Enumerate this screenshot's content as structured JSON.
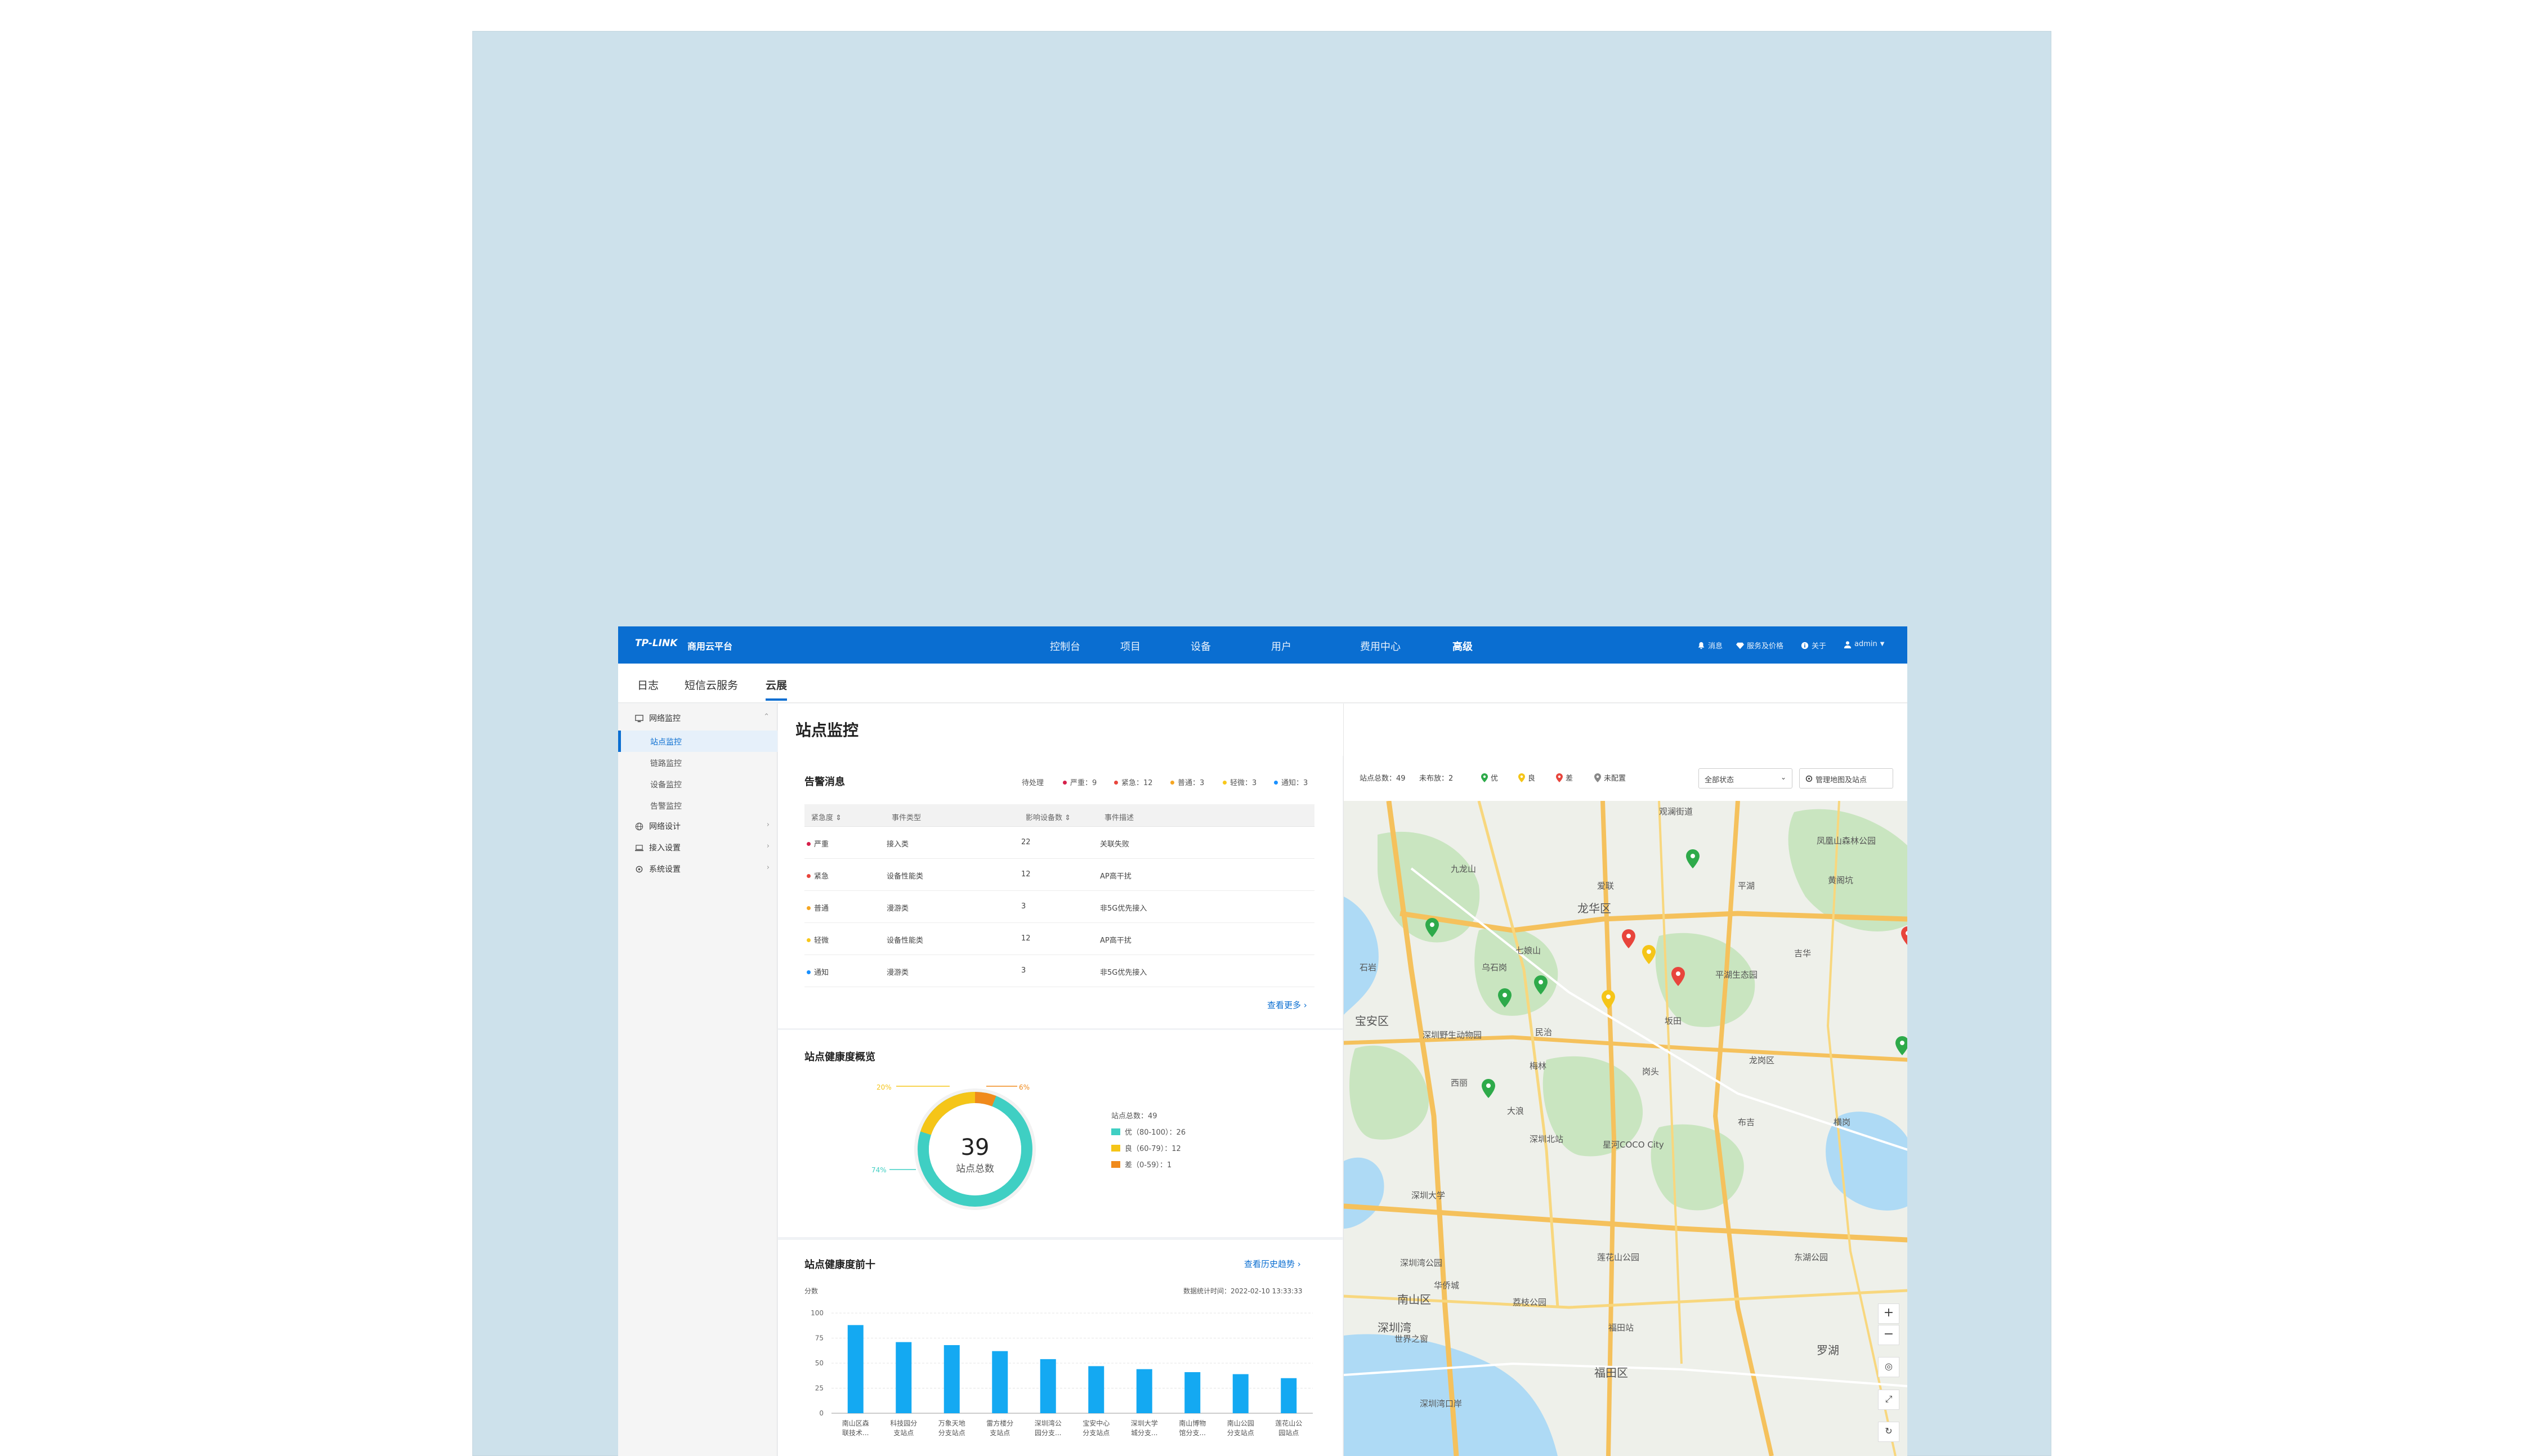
{
  "topbar": {
    "logo": "TP-LINK",
    "brand": "商用云平台",
    "nav": [
      "控制台",
      "项目",
      "设备",
      "用户",
      "费用中心",
      "高级"
    ],
    "active_nav": "高级",
    "right": {
      "notice": "消息",
      "service": "服务及价格",
      "about": "关于",
      "user": "admin"
    }
  },
  "subnav": {
    "tabs": [
      "日志",
      "短信云服务",
      "云展"
    ],
    "active": "云展"
  },
  "sidebar": {
    "group_monitor": "网络监控",
    "items": [
      "站点监控",
      "链路监控",
      "设备监控",
      "告警监控"
    ],
    "active_item": "站点监控",
    "group_design": "网络设计",
    "group_access": "接入设置",
    "group_system": "系统设置"
  },
  "page": {
    "title": "站点监控"
  },
  "alarms": {
    "title": "告警消息",
    "pending": "待处理",
    "counts": [
      {
        "label": "严重：9",
        "color": "#d6204b"
      },
      {
        "label": "紧急：12",
        "color": "#e8453c"
      },
      {
        "label": "普通：3",
        "color": "#f5a623"
      },
      {
        "label": "轻微：3",
        "color": "#f8c81c"
      },
      {
        "label": "通知：3",
        "color": "#1890ff"
      }
    ],
    "headers": [
      "紧急度",
      "事件类型",
      "影响设备数",
      "事件描述"
    ],
    "rows": [
      {
        "level": "严重",
        "color": "#d6204b",
        "type": "接入类",
        "count": "22",
        "desc": "关联失败"
      },
      {
        "level": "紧急",
        "color": "#e8453c",
        "type": "设备性能类",
        "count": "12",
        "desc": "AP高干扰"
      },
      {
        "level": "普通",
        "color": "#f5a623",
        "type": "漫游类",
        "count": "3",
        "desc": "非5G优先接入"
      },
      {
        "level": "轻微",
        "color": "#f8c81c",
        "type": "设备性能类",
        "count": "12",
        "desc": "AP高干扰"
      },
      {
        "level": "通知",
        "color": "#1890ff",
        "type": "漫游类",
        "count": "3",
        "desc": "非5G优先接入"
      }
    ],
    "more": "查看更多"
  },
  "health": {
    "title": "站点健康度概览",
    "center_value": "39",
    "center_label": "站点总数",
    "pct_good": "74%",
    "pct_fair": "20%",
    "pct_poor": "6%",
    "legend_total": "站点总数：49",
    "legend": [
      {
        "label": "优（80-100）：26",
        "color": "#3fcfc3"
      },
      {
        "label": "良（60-79）：12",
        "color": "#f5c518"
      },
      {
        "label": "差（0-59）：1",
        "color": "#f08a1c"
      }
    ]
  },
  "top10": {
    "title": "站点健康度前十",
    "link": "查看历史趋势",
    "ylabel": "分数",
    "stat_time": "数据统计时间：2022-02-10 13:33:33"
  },
  "chart_data": {
    "type": "bar",
    "title": "站点健康度前十",
    "ylabel": "分数",
    "ylim": [
      0,
      100
    ],
    "yticks": [
      0,
      25,
      50,
      75,
      100
    ],
    "categories": [
      "南山区森联技术...",
      "科技园分支站点",
      "万象天地分支站点",
      "雷方楼分支站点",
      "深圳湾公园分支...",
      "宝安中心分支站点",
      "深圳大学城分支...",
      "南山博物馆分支...",
      "南山公园分支站点",
      "莲花山公园站点"
    ],
    "category_lines": [
      [
        "南山区森",
        "联技术..."
      ],
      [
        "科技园分",
        "支站点"
      ],
      [
        "万象天地",
        "分支站点"
      ],
      [
        "雷方楼分",
        "支站点"
      ],
      [
        "深圳湾公",
        "园分支..."
      ],
      [
        "宝安中心",
        "分支站点"
      ],
      [
        "深圳大学",
        "城分支..."
      ],
      [
        "南山博物",
        "馆分支..."
      ],
      [
        "南山公园",
        "分支站点"
      ],
      [
        "莲花山公",
        "园站点"
      ]
    ],
    "values": [
      88,
      71,
      68,
      62,
      54,
      47,
      44,
      41,
      39,
      35
    ],
    "color": "#14a9f2"
  },
  "map": {
    "total": "站点总数：49",
    "unconnected": "未布放：2",
    "legend": [
      {
        "label": "优",
        "color": "#2eaa4a"
      },
      {
        "label": "良",
        "color": "#f5c518"
      },
      {
        "label": "差",
        "color": "#e8453c"
      },
      {
        "label": "未配置",
        "color": "#888888"
      }
    ],
    "select": "全部状态",
    "manage": "管理地图及站点",
    "places": [
      "观澜街道",
      "龙华区",
      "九龙山",
      "石岩",
      "乌石岗",
      "七娘山",
      "梅林",
      "西丽",
      "深圳大学",
      "南山区",
      "福田区",
      "福田站",
      "罗湖",
      "莲花山公园",
      "深圳北站",
      "星河COCO City",
      "平湖生态园",
      "坂田",
      "龙岗区",
      "布吉",
      "民治",
      "大浪",
      "深圳湾",
      "深圳湾公园",
      "世界之窗",
      "华侨城",
      "深圳野生动物园",
      "凤凰山森林公园",
      "宝安区",
      "深圳湾口岸",
      "荔枝公园",
      "东湖公园",
      "岗头",
      "吉华",
      "平湖",
      "横岗",
      "爱联",
      "黄阁坑"
    ]
  }
}
